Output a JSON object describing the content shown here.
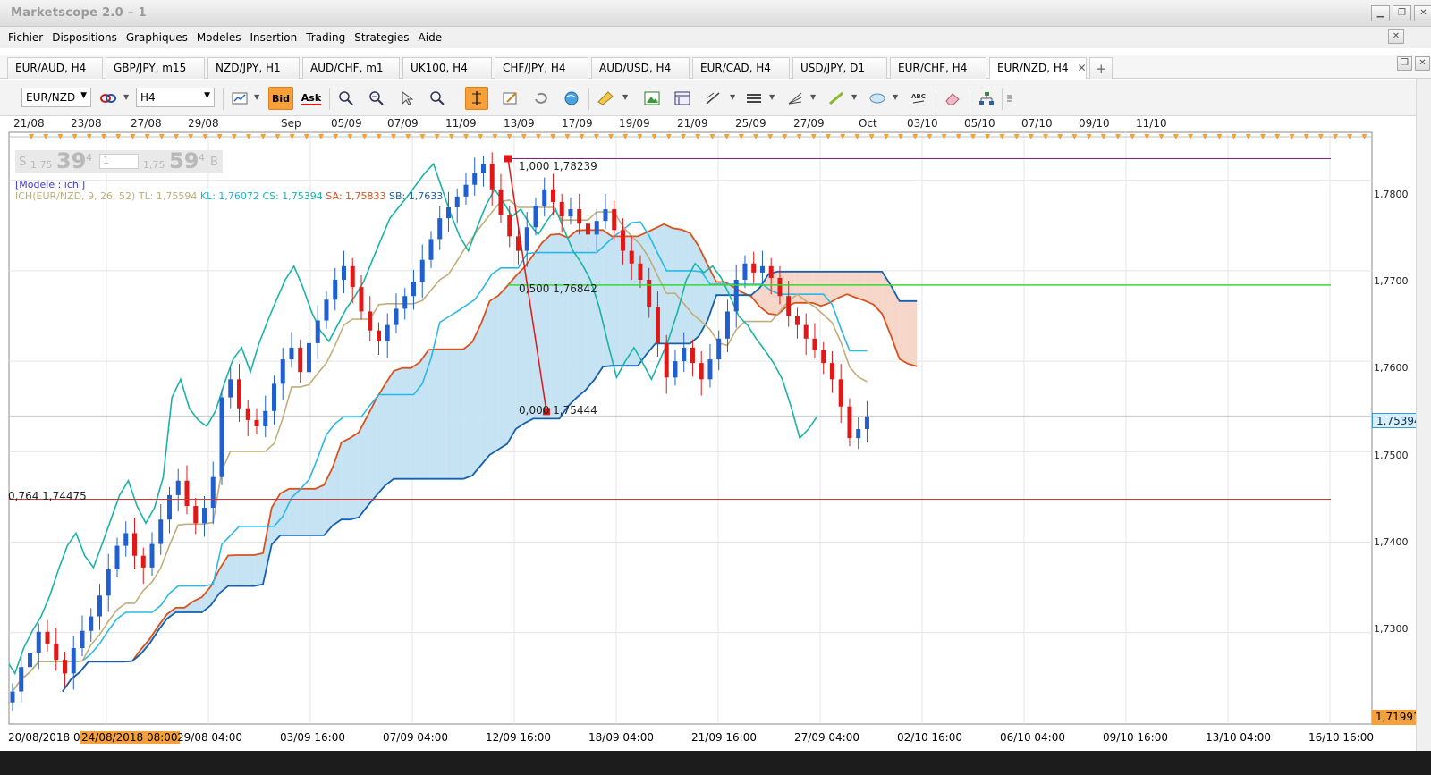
{
  "window": {
    "title": "Marketscope 2.0 – 1"
  },
  "menu": [
    "Fichier",
    "Dispositions",
    "Graphiques",
    "Modeles",
    "Insertion",
    "Trading",
    "Strategies",
    "Aide"
  ],
  "tabs": [
    "EUR/AUD, H4",
    "GBP/JPY, m15",
    "NZD/JPY, H1",
    "AUD/CHF, m1",
    "UK100, H4",
    "CHF/JPY, H4",
    "AUD/USD, H4",
    "EUR/CAD, H4",
    "USD/JPY, D1",
    "EUR/CHF, H4",
    "EUR/NZD, H4"
  ],
  "toolbar": {
    "symbol": "EUR/NZD",
    "timeframe": "H4",
    "bid_label": "Bid",
    "ask_label": "Ask"
  },
  "date_strip": [
    "21/08",
    "23/08",
    "27/08",
    "29/08",
    "Sep",
    "05/09",
    "07/09",
    "11/09",
    "13/09",
    "17/09",
    "19/09",
    "21/09",
    "25/09",
    "27/09",
    "Oct",
    "03/10",
    "05/10",
    "07/10",
    "09/10",
    "11/10"
  ],
  "hud": {
    "sell_prefix": "S",
    "sell_small": "1,75",
    "sell_big": "39",
    "sell_sup": "4",
    "amount": "1",
    "buy_small": "1,75",
    "buy_big": "59",
    "buy_sup": "4",
    "buy_suffix": "B"
  },
  "indicator": {
    "model": "[Modele : ichi]",
    "prefix": "ICH(EUR/NZD, 9, 26, 52)",
    "tl": "TL: 1,75594",
    "kl": "KL: 1,76072",
    "cs": "CS: 1,75394",
    "sa": "SA: 1,75833",
    "sb": "SB: 1,7633"
  },
  "fibo": {
    "level_1000": "1,000 1,78239",
    "level_0500": "0,500 1,76842",
    "level_0000": "0,000 1,75444",
    "level_0764": "0,764 1,74475"
  },
  "price_axis": [
    "1,7800",
    "1,7700",
    "1,7600",
    "1,7500",
    "1,7400",
    "1,7300"
  ],
  "price_tags": {
    "current": "1,75394",
    "low": "1,71991"
  },
  "time_axis": {
    "labels": [
      "20/08/2018 0",
      "29/08 04:00",
      "03/09 16:00",
      "07/09 04:00",
      "12/09 16:00",
      "18/09 04:00",
      "21/09 16:00",
      "27/09 04:00",
      "02/10 16:00",
      "06/10 04:00",
      "09/10 16:00",
      "13/10 04:00",
      "16/10 16:00"
    ],
    "highlight": "24/08/2018 08:00"
  },
  "colors": {
    "bull": "#1f5fd0",
    "bear": "#e01818",
    "tenkan": "#bfae7a",
    "kijun": "#1e88c8",
    "chikou": "#1ab3a6",
    "span_a": "#d9521e",
    "span_b": "#1560b0",
    "cloud_up": "#c5e3f2",
    "cloud_down": "#f6d6c8",
    "fibo_top": "#8b1c8b",
    "fibo_mid": "#38d838",
    "fibo_bot": "#e03030",
    "accent": "#f6a03c"
  },
  "chart_data": {
    "type": "candlestick",
    "symbol": "EUR/NZD",
    "timeframe": "H4",
    "ylim": [
      1.7199,
      1.7853
    ],
    "fib_levels": [
      {
        "ratio": "1,000",
        "value": 1.78239
      },
      {
        "ratio": "0,500",
        "value": 1.76842
      },
      {
        "ratio": "0,000",
        "value": 1.75444
      },
      {
        "ratio": "0,764",
        "value": 1.74475
      }
    ],
    "closes": [
      1.7235,
      1.7262,
      1.7278,
      1.7301,
      1.7288,
      1.727,
      1.7255,
      1.7283,
      1.7302,
      1.7318,
      1.7341,
      1.737,
      1.7396,
      1.741,
      1.7385,
      1.7372,
      1.7398,
      1.7425,
      1.7452,
      1.7468,
      1.744,
      1.7421,
      1.7438,
      1.7472,
      1.756,
      1.758,
      1.7548,
      1.7535,
      1.7528,
      1.7545,
      1.7575,
      1.7602,
      1.7615,
      1.7588,
      1.762,
      1.7645,
      1.7668,
      1.769,
      1.7705,
      1.7682,
      1.7655,
      1.7634,
      1.7622,
      1.764,
      1.7658,
      1.7672,
      1.7688,
      1.7712,
      1.7735,
      1.7758,
      1.777,
      1.7782,
      1.7795,
      1.7808,
      1.7818,
      1.779,
      1.7762,
      1.7738,
      1.7722,
      1.7748,
      1.7772,
      1.779,
      1.7776,
      1.776,
      1.7768,
      1.7752,
      1.774,
      1.7755,
      1.7768,
      1.7745,
      1.7722,
      1.7708,
      1.769,
      1.766,
      1.762,
      1.7582,
      1.76,
      1.7615,
      1.7598,
      1.758,
      1.7602,
      1.7625,
      1.7655,
      1.769,
      1.7708,
      1.7698,
      1.7705,
      1.7692,
      1.7672,
      1.765,
      1.764,
      1.7625,
      1.7612,
      1.7598,
      1.758,
      1.755,
      1.7515,
      1.7525,
      1.7539
    ]
  }
}
